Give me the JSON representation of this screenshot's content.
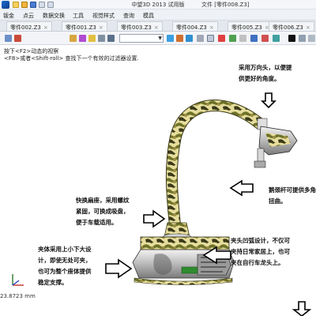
{
  "titlebar": {
    "app_title": "中望3D 2013 试用版",
    "file_title": "文件 [零件008.Z3]"
  },
  "menu": {
    "items": [
      "钣金",
      "点云",
      "数据交换",
      "工具",
      "视觉样式",
      "查询",
      "模具"
    ]
  },
  "tabs": [
    "零件002.Z3",
    "零件001.Z3",
    "零件003.Z3",
    "零件004.Z3",
    "零件005.Z3",
    "零件006.Z3"
  ],
  "toolbar": {
    "combo_value": ""
  },
  "viewport": {
    "hint_line1": "按下<F2>动态的视察",
    "hint_line2": "<F8>或者<Shift-roll> 查找下一个有效的过滤器设置.",
    "coords": "23.8723 mm"
  },
  "annotations": {
    "a1": "采用万向头，以便提\n供更好的角度。",
    "a2": "鹅颈杆可提供多角\n扭曲。",
    "a3": "快换扁座，采用螺纹\n紧固，可换成吸盘，\n便于车载适用。",
    "a4": "夹体采用上小下大设\n计，即使无处可夹，\n也可为整个座体提供\n稳定支撑。",
    "a5": "夹头凹弧设计，不仅可\n夹持日常家居上，也可\n夹在自行车龙头上。"
  },
  "colors": {
    "accent": "#2b6cd4",
    "camo_dark": "#3b3a1c",
    "camo_light": "#e7dfa0",
    "camo_green": "#6b6f2a",
    "metal": "#c8c8c8"
  }
}
